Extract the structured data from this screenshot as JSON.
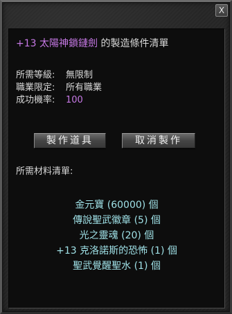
{
  "window": {
    "close_label": "X"
  },
  "header": {
    "item_name": "+13 太陽神鎖鏈劍",
    "title_suffix": " 的製造條件清單"
  },
  "conditions": [
    {
      "label": "所需等級:",
      "value": "無限制"
    },
    {
      "label": "職業限定:",
      "value": "所有職業"
    },
    {
      "label": "成功機率:",
      "value": "100"
    }
  ],
  "buttons": {
    "make_label": "製作道具",
    "cancel_label": "取消製作"
  },
  "materials_heading": "所需材料清單:",
  "materials": [
    "金元寶 (60000) 個",
    "傳說聖武徽章 (5) 個",
    "光之靈魂 (20) 個",
    "+13 克洛諾斯的恐怖 (1) 個",
    "聖武覺醒聖水 (1) 個"
  ],
  "colors": {
    "highlight_purple": "#c779e6",
    "material_cyan": "#9fe0e6",
    "text_light": "#d8d8d8"
  }
}
